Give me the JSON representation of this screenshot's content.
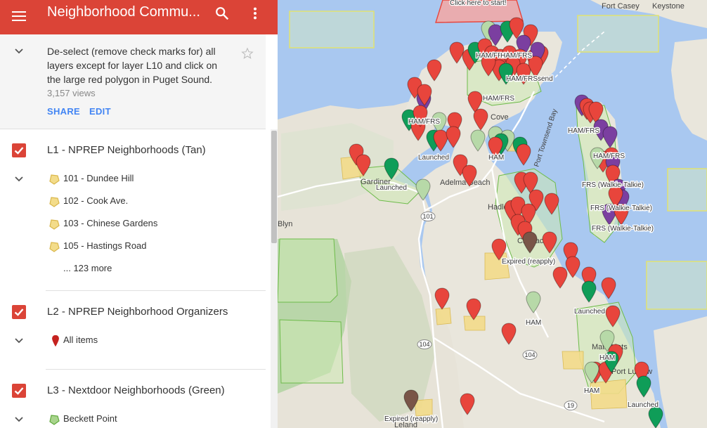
{
  "header": {
    "title": "Neighborhood Commu...",
    "menu_icon": "hamburger-menu-icon",
    "search_icon": "search-icon",
    "more_icon": "more-vert-icon"
  },
  "description": {
    "text": "De-select (remove check marks for) all layers except for layer L10 and click on the large red polygon in Puget Sound.",
    "views": "3,157 views",
    "share_label": "SHARE",
    "edit_label": "EDIT"
  },
  "layers": [
    {
      "title": "L1 - NPREP Neighborhoods (Tan)",
      "items": [
        "101 - Dundee Hill",
        "102 - Cook Ave.",
        "103 - Chinese Gardens",
        "105 - Hastings Road"
      ],
      "more": "... 123 more"
    },
    {
      "title": "L2 - NPREP Neighborhood Organizers",
      "items": [
        "All items"
      ]
    },
    {
      "title": "L3 - Nextdoor Neighborhoods (Green)",
      "items": [
        "Beckett Point"
      ]
    }
  ],
  "map": {
    "place_labels": [
      {
        "text": "Fort Casey"
      },
      {
        "text": "Keystone"
      },
      {
        "text": "Port Townsend Bay"
      },
      {
        "text": "Adelma Beach"
      },
      {
        "text": "Gardiner"
      },
      {
        "text": "Blyn"
      },
      {
        "text": "Mats Mats"
      },
      {
        "text": "Leland"
      },
      {
        "text": "Hadlock"
      },
      {
        "text": "Chimacum"
      },
      {
        "text": "Cove"
      },
      {
        "text": "Port Ludlow"
      }
    ],
    "marker_labels": [
      {
        "text": "Click here to start!"
      },
      {
        "text": "HAM/FRS"
      },
      {
        "text": "HAM/FRS"
      },
      {
        "text": "HAM/FRSsend"
      },
      {
        "text": "HAM/FRS"
      },
      {
        "text": "HAM/FRS"
      },
      {
        "text": "HAM/FRS"
      },
      {
        "text": "HAM/FRS"
      },
      {
        "text": "HAM"
      },
      {
        "text": "Launched"
      },
      {
        "text": "Launched"
      },
      {
        "text": "FRS (Walkie-Talkie)"
      },
      {
        "text": "FRS (Walkie-Talkie)"
      },
      {
        "text": "FRS (Walkie-Talkie)"
      },
      {
        "text": "Expired (reapply)"
      },
      {
        "text": "Launched"
      },
      {
        "text": "HAM"
      },
      {
        "text": "HAM"
      },
      {
        "text": "HAM"
      },
      {
        "text": "Launched"
      },
      {
        "text": "Expired (reapply)"
      }
    ],
    "route_labels": [
      "101",
      "104",
      "104",
      "19"
    ],
    "marker_colors": {
      "red": "#e8453c",
      "green": "#0f9d58",
      "light_green": "#b7d9a8",
      "purple": "#7b3fa0",
      "brown": "#795548"
    }
  }
}
